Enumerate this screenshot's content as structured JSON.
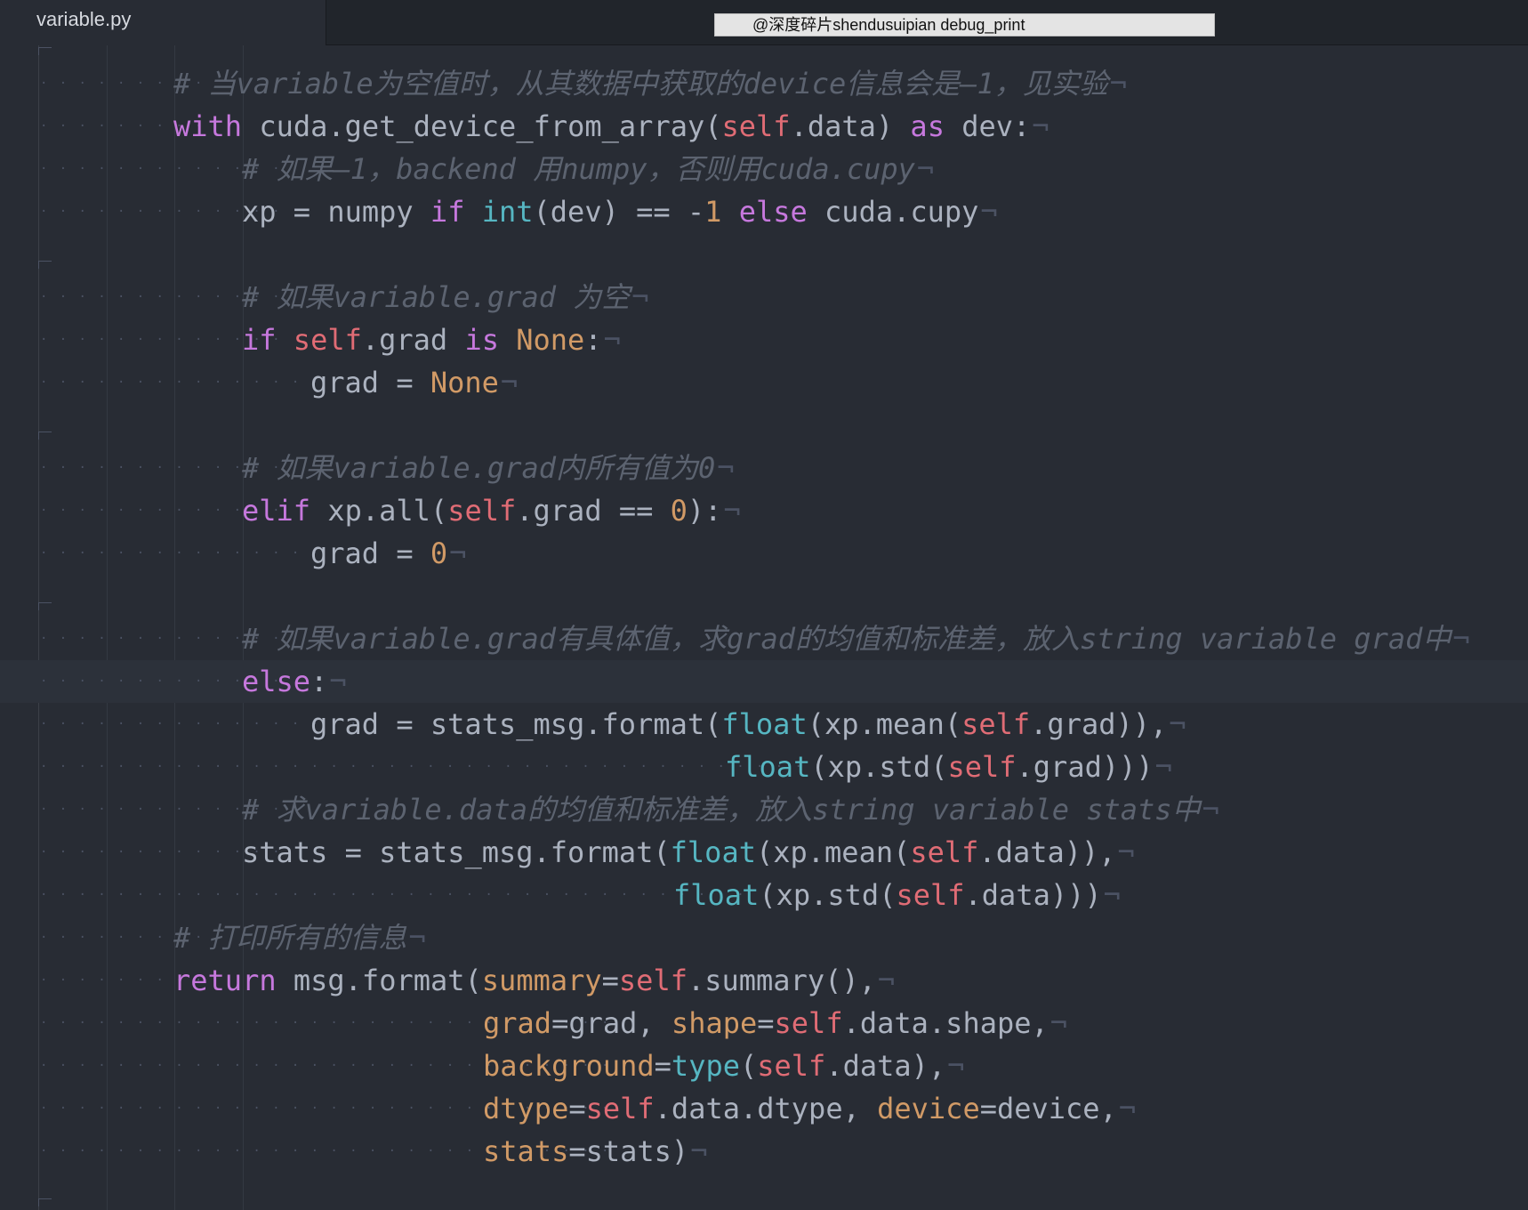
{
  "tab": {
    "filename": "variable.py"
  },
  "watermark": {
    "text": "@深度碎片shendusuipian debug_print"
  },
  "colors": {
    "background": "#282c34",
    "comment": "#5c6370",
    "keyword": "#c678dd",
    "self": "#e06c75",
    "number_constant": "#d19a66",
    "builtin": "#56b6c2",
    "plain": "#abb2bf"
  },
  "eol_marker": "¬",
  "lines": [
    {
      "ws": "· · · · · · · · · ",
      "indent": 1,
      "tokens": [
        {
          "t": "c",
          "v": "# 当variable为空值时，从其数据中获取的device信息会是–1，见实验"
        }
      ]
    },
    {
      "ws": "· · · · · · · · · ",
      "indent": 1,
      "tokens": [
        {
          "t": "k",
          "v": "with"
        },
        {
          "t": "p",
          "v": " cuda.get_device_from_array("
        },
        {
          "t": "s",
          "v": "self"
        },
        {
          "t": "p",
          "v": ".data) "
        },
        {
          "t": "k",
          "v": "as"
        },
        {
          "t": "p",
          "v": " dev:"
        }
      ]
    },
    {
      "ws": "· · · · · · · · · · · · · ",
      "indent": 2,
      "tokens": [
        {
          "t": "c",
          "v": "# 如果–1，backend 用numpy，否则用cuda.cupy"
        }
      ]
    },
    {
      "ws": "· · · · · · · · · · · · · ",
      "indent": 2,
      "tokens": [
        {
          "t": "p",
          "v": "xp = numpy "
        },
        {
          "t": "k",
          "v": "if"
        },
        {
          "t": "p",
          "v": " "
        },
        {
          "t": "b",
          "v": "int"
        },
        {
          "t": "p",
          "v": "(dev) == -"
        },
        {
          "t": "n",
          "v": "1"
        },
        {
          "t": "p",
          "v": " "
        },
        {
          "t": "k",
          "v": "else"
        },
        {
          "t": "p",
          "v": " cuda.cupy"
        }
      ]
    },
    {
      "ws": "",
      "indent": 0,
      "tokens": [],
      "noeol": true
    },
    {
      "ws": "· · · · · · · · · · · · · ",
      "indent": 2,
      "tokens": [
        {
          "t": "c",
          "v": "# 如果variable.grad 为空"
        }
      ]
    },
    {
      "ws": "· · · · · · · · · · · · · ",
      "indent": 2,
      "tokens": [
        {
          "t": "k",
          "v": "if"
        },
        {
          "t": "p",
          "v": " "
        },
        {
          "t": "s",
          "v": "self"
        },
        {
          "t": "p",
          "v": ".grad "
        },
        {
          "t": "k",
          "v": "is"
        },
        {
          "t": "p",
          "v": " "
        },
        {
          "t": "n",
          "v": "None"
        },
        {
          "t": "p",
          "v": ":"
        }
      ]
    },
    {
      "ws": "· · · · · · · · · · · · · · · · · ",
      "indent": 3,
      "tokens": [
        {
          "t": "p",
          "v": "grad = "
        },
        {
          "t": "n",
          "v": "None"
        }
      ]
    },
    {
      "ws": "",
      "indent": 0,
      "tokens": [],
      "noeol": true
    },
    {
      "ws": "· · · · · · · · · · · · · ",
      "indent": 2,
      "tokens": [
        {
          "t": "c",
          "v": "# 如果variable.grad内所有值为0"
        }
      ]
    },
    {
      "ws": "· · · · · · · · · · · · · ",
      "indent": 2,
      "tokens": [
        {
          "t": "k",
          "v": "elif"
        },
        {
          "t": "p",
          "v": " xp.all("
        },
        {
          "t": "s",
          "v": "self"
        },
        {
          "t": "p",
          "v": ".grad == "
        },
        {
          "t": "n",
          "v": "0"
        },
        {
          "t": "p",
          "v": "):"
        }
      ]
    },
    {
      "ws": "· · · · · · · · · · · · · · · · · ",
      "indent": 3,
      "tokens": [
        {
          "t": "p",
          "v": "grad = "
        },
        {
          "t": "n",
          "v": "0"
        }
      ]
    },
    {
      "ws": "",
      "indent": 0,
      "tokens": [],
      "noeol": true
    },
    {
      "ws": "· · · · · · · · · · · · · ",
      "indent": 2,
      "tokens": [
        {
          "t": "c",
          "v": "# 如果variable.grad有具体值，求grad的均值和标准差，放入string variable grad中"
        }
      ]
    },
    {
      "ws": "· · · · · · · · · · · · · ",
      "indent": 2,
      "active": true,
      "tokens": [
        {
          "t": "k",
          "v": "else"
        },
        {
          "t": "p",
          "v": ":"
        }
      ]
    },
    {
      "ws": "· · · · · · · · · · · · · · · · · ",
      "indent": 3,
      "tokens": [
        {
          "t": "p",
          "v": "grad = stats_msg.format("
        },
        {
          "t": "b",
          "v": "float"
        },
        {
          "t": "p",
          "v": "(xp.mean("
        },
        {
          "t": "s",
          "v": "self"
        },
        {
          "t": "p",
          "v": ".grad)),"
        }
      ]
    },
    {
      "ws": "· · · · · · · · · · · · · · · · · · · · · · · · · · · · · · · · · · · · · · · · · ",
      "indent": 9,
      "tokens": [
        {
          "t": "b",
          "v": "float"
        },
        {
          "t": "p",
          "v": "(xp.std("
        },
        {
          "t": "s",
          "v": "self"
        },
        {
          "t": "p",
          "v": ".grad)))"
        }
      ]
    },
    {
      "ws": "· · · · · · · · · · · · · ",
      "indent": 2,
      "tokens": [
        {
          "t": "c",
          "v": "# 求variable.data的均值和标准差，放入string variable stats中"
        }
      ]
    },
    {
      "ws": "· · · · · · · · · · · · · ",
      "indent": 2,
      "tokens": [
        {
          "t": "p",
          "v": "stats = stats_msg.format("
        },
        {
          "t": "b",
          "v": "float"
        },
        {
          "t": "p",
          "v": "(xp.mean("
        },
        {
          "t": "s",
          "v": "self"
        },
        {
          "t": "p",
          "v": ".data)),"
        }
      ]
    },
    {
      "ws": "· · · · · · · · · · · · · · · · · · · · · · · · · · · · · · · · · · · · · ",
      "indent": 8,
      "tokens": [
        {
          "t": "b",
          "v": "float"
        },
        {
          "t": "p",
          "v": "(xp.std("
        },
        {
          "t": "s",
          "v": "self"
        },
        {
          "t": "p",
          "v": ".data)))"
        }
      ]
    },
    {
      "ws": "· · · · · · · · · ",
      "indent": 1,
      "tokens": [
        {
          "t": "c",
          "v": "# 打印所有的信息"
        }
      ]
    },
    {
      "ws": "· · · · · · · · · ",
      "indent": 1,
      "tokens": [
        {
          "t": "k",
          "v": "return"
        },
        {
          "t": "p",
          "v": " msg.format("
        },
        {
          "t": "kw",
          "v": "summary"
        },
        {
          "t": "p",
          "v": "="
        },
        {
          "t": "s",
          "v": "self"
        },
        {
          "t": "p",
          "v": ".summary(),"
        }
      ]
    },
    {
      "ws": "· · · · · · · · · · · · · · · · · · · · · · · · · · · · · · ",
      "indent": 5,
      "tokens": [
        {
          "t": "kw",
          "v": "grad"
        },
        {
          "t": "p",
          "v": "=grad, "
        },
        {
          "t": "kw",
          "v": "shape"
        },
        {
          "t": "p",
          "v": "="
        },
        {
          "t": "s",
          "v": "self"
        },
        {
          "t": "p",
          "v": ".data.shape,"
        }
      ]
    },
    {
      "ws": "· · · · · · · · · · · · · · · · · · · · · · · · · · · · · · ",
      "indent": 5,
      "tokens": [
        {
          "t": "kw",
          "v": "background"
        },
        {
          "t": "p",
          "v": "="
        },
        {
          "t": "b",
          "v": "type"
        },
        {
          "t": "p",
          "v": "("
        },
        {
          "t": "s",
          "v": "self"
        },
        {
          "t": "p",
          "v": ".data),"
        }
      ]
    },
    {
      "ws": "· · · · · · · · · · · · · · · · · · · · · · · · · · · · · · ",
      "indent": 5,
      "tokens": [
        {
          "t": "kw",
          "v": "dtype"
        },
        {
          "t": "p",
          "v": "="
        },
        {
          "t": "s",
          "v": "self"
        },
        {
          "t": "p",
          "v": ".data.dtype, "
        },
        {
          "t": "kw",
          "v": "device"
        },
        {
          "t": "p",
          "v": "=device,"
        }
      ]
    },
    {
      "ws": "· · · · · · · · · · · · · · · · · · · · · · · · · · · · · · ",
      "indent": 5,
      "tokens": [
        {
          "t": "kw",
          "v": "stats"
        },
        {
          "t": "p",
          "v": "=stats)"
        }
      ]
    }
  ]
}
